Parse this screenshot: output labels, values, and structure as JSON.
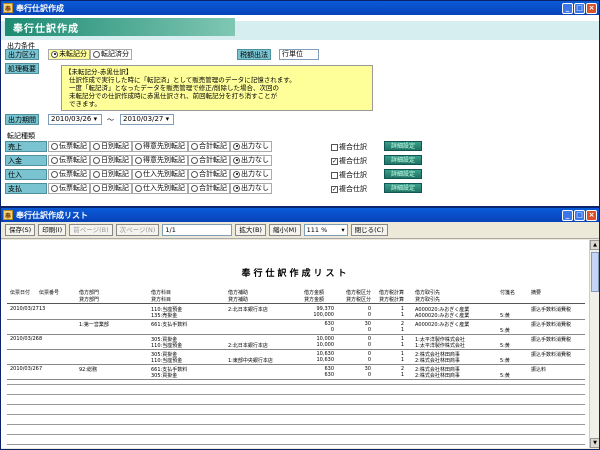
{
  "main_window": {
    "title": "奉行仕訳作成",
    "banner": "奉行仕訳作成",
    "conditions_label": "出力条件",
    "output_type": {
      "label": "出力区分",
      "options": [
        "未転記分",
        "転記済分"
      ],
      "selected": 0
    },
    "tax_method": {
      "label": "税額出法",
      "value": "行単位"
    },
    "processing": {
      "label": "処理概要",
      "lines": [
        "【未転記分-赤黒仕訳】",
        "仕訳作成で実行した時に「転記済」として販売管理のデータに記憶されます。",
        "一度「転記済」となったデータを販売管理で修正/削除した場合、次回の",
        "未転記分での仕訳作成時に赤黒仕訳され、前回転記分を打ち消すことが",
        "できます。"
      ]
    },
    "period": {
      "label": "出力期間",
      "from": "2010/03/26",
      "sep": "〜",
      "to": "2010/03/27"
    },
    "transfer_label": "転記種類",
    "rows": [
      {
        "label": "売上",
        "options": [
          "伝票転記",
          "日別転記",
          "得意先別転記",
          "合計転記",
          "出力なし"
        ],
        "selected": 4,
        "compound": "複合仕訳",
        "checked": false,
        "btn": "詳細設定"
      },
      {
        "label": "入金",
        "options": [
          "伝票転記",
          "日別転記",
          "得意先別転記",
          "合計転記",
          "出力なし"
        ],
        "selected": 4,
        "compound": "複合仕訳",
        "checked": true,
        "btn": "詳細設定"
      },
      {
        "label": "仕入",
        "options": [
          "伝票転記",
          "日別転記",
          "仕入先別転記",
          "合計転記",
          "出力なし"
        ],
        "selected": 4,
        "compound": "複合仕訳",
        "checked": false,
        "btn": "詳細設定"
      },
      {
        "label": "支払",
        "options": [
          "伝票転記",
          "日別転記",
          "仕入先別転記",
          "合計転記",
          "出力なし"
        ],
        "selected": 4,
        "compound": "複合仕訳",
        "checked": true,
        "btn": "詳細設定"
      }
    ]
  },
  "list_window": {
    "title": "奉行仕訳作成リスト",
    "toolbar": {
      "save": "保存(S)",
      "print": "印刷(I)",
      "prev": "前ページ(B)",
      "next": "次ページ(N)",
      "page": "1/1",
      "zoom_in": "拡大(B)",
      "zoom_out": "縮小(M)",
      "zoom": "111 %",
      "close": "閉じる(C)"
    },
    "report_title": "奉行仕訳作成リスト",
    "headers": {
      "date": "伝票日付",
      "slip": "伝票番号",
      "dept": "借方部門",
      "dept2": "貸方部門",
      "acct": "借方科目",
      "acct2": "貸方科目",
      "sub": "借方補助",
      "sub2": "貸方補助",
      "amt": "借方金額",
      "amt2": "貸方金額",
      "taxcat": "借方税区分",
      "taxcat2": "貸方税区分",
      "taxcalc": "借方税計算",
      "taxcalc2": "貸方税計算",
      "partner": "借方取引先",
      "partner2": "貸方取引先",
      "memo": "付箋名",
      "note": "摘要"
    },
    "entries": [
      {
        "date": "2010/03/27",
        "slip": "13",
        "dept": "",
        "dept2": "",
        "acct": "110:当座預金",
        "acct2": "135:売掛金",
        "sub": "2:北日本銀行本店",
        "sub2": "",
        "amt": "99,370",
        "amt2": "100,000",
        "tc": "0",
        "tc2": "0",
        "calc": "1",
        "calc2": "1",
        "partner": "A000020:みおぎく産業",
        "partner2": "A000020:みおぎく産業",
        "memo": "5:黄",
        "note": "振込手数料消費税"
      },
      {
        "date": "",
        "slip": "",
        "dept": "1:第一営業部",
        "dept2": "",
        "acct": "661:支払手数料",
        "acct2": "",
        "sub": "",
        "sub2": "",
        "amt": "630",
        "amt2": "0",
        "tc": "30",
        "tc2": "0",
        "calc": "2",
        "calc2": "1",
        "partner": "A000020:みおぎく産業",
        "partner2": "",
        "memo": "5:黄",
        "note": "振込手数料消費税"
      },
      {
        "date": "2010/03/26",
        "slip": "8",
        "dept": "",
        "dept2": "",
        "acct": "305:買掛金",
        "acct2": "110:当座預金",
        "sub": "",
        "sub2": "2:北日本銀行本店",
        "amt": "10,000",
        "amt2": "10,000",
        "tc": "0",
        "tc2": "0",
        "calc": "1",
        "calc2": "1",
        "partner": "1:太平洋製作株式会社",
        "partner2": "1:太平洋製作株式会社",
        "memo": "5:黄",
        "note": "振込手数料消費税"
      },
      {
        "date": "",
        "slip": "",
        "dept": "",
        "dept2": "",
        "acct": "305:買掛金",
        "acct2": "110:当座預金",
        "sub": "",
        "sub2": "1:東部中央銀行本店",
        "amt": "10,630",
        "amt2": "10,630",
        "tc": "0",
        "tc2": "0",
        "calc": "1",
        "calc2": "1",
        "partner": "2:株式会社林田商事",
        "partner2": "2:株式会社林田商事",
        "memo": "5:黄",
        "note": "振込手数料消費税"
      },
      {
        "date": "2010/03/26",
        "slip": "7",
        "dept": "92:総務",
        "dept2": "",
        "acct": "661:支払手数料",
        "acct2": "305:買掛金",
        "sub": "",
        "sub2": "",
        "amt": "630",
        "amt2": "630",
        "tc": "30",
        "tc2": "0",
        "calc": "2",
        "calc2": "1",
        "partner": "2:株式会社林田商事",
        "partner2": "2:株式会社林田商事",
        "memo": "5:黄",
        "note": "振込料"
      }
    ]
  }
}
